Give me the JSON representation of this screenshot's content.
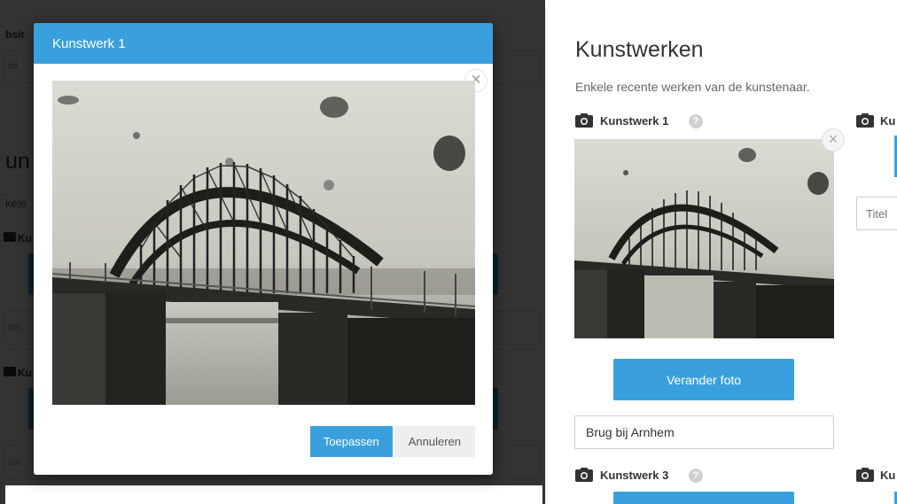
{
  "background": {
    "label_partial_top": "bsit",
    "input_partial_top": "tto",
    "heading_partial": "un",
    "subtitle_partial": "kele",
    "label_partial_1": "Ku",
    "input_partial_1": "itel",
    "label_partial_2": "Ku",
    "input_partial_2": "itel"
  },
  "modal": {
    "title": "Kunstwerk 1",
    "close_symbol": "×",
    "apply_label": "Toepassen",
    "cancel_label": "Annuleren"
  },
  "panel": {
    "title": "Kunstwerken",
    "subtitle": "Enkele recente werken van de kunstenaar.",
    "item1_label": "Kunstwerk 1",
    "item2_label_partial": "Ku",
    "item3_label": "Kunstwerk 3",
    "item4_label_partial": "Ku",
    "help_symbol": "?",
    "thumb_close_symbol": "×",
    "change_photo_label": "Verander foto",
    "title_value": "Brug bij Arnhem",
    "title2_placeholder": "Titel"
  },
  "colors": {
    "accent": "#3aa0dd",
    "overlay": "rgba(0,0,0,0.80)"
  },
  "icons": [
    "camera-icon",
    "help-icon",
    "close-icon"
  ]
}
